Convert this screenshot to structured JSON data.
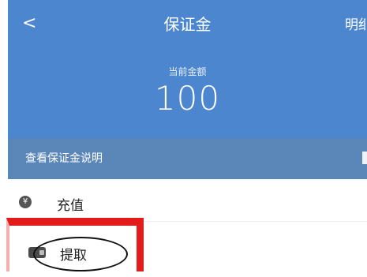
{
  "header": {
    "back_label": "<",
    "title": "保证金",
    "detail_label": "明细",
    "amount_label": "当前金额",
    "amount_value": "100"
  },
  "info_bar": {
    "label": "查看保证金说明"
  },
  "actions": [
    {
      "label": "充值",
      "icon": "yen-icon"
    },
    {
      "label": "提取",
      "icon": "wallet-icon"
    }
  ],
  "colors": {
    "header_bg": "#4b86cf",
    "info_bar_bg": "#5b86b8",
    "annotation_red": "#e21b1b"
  }
}
